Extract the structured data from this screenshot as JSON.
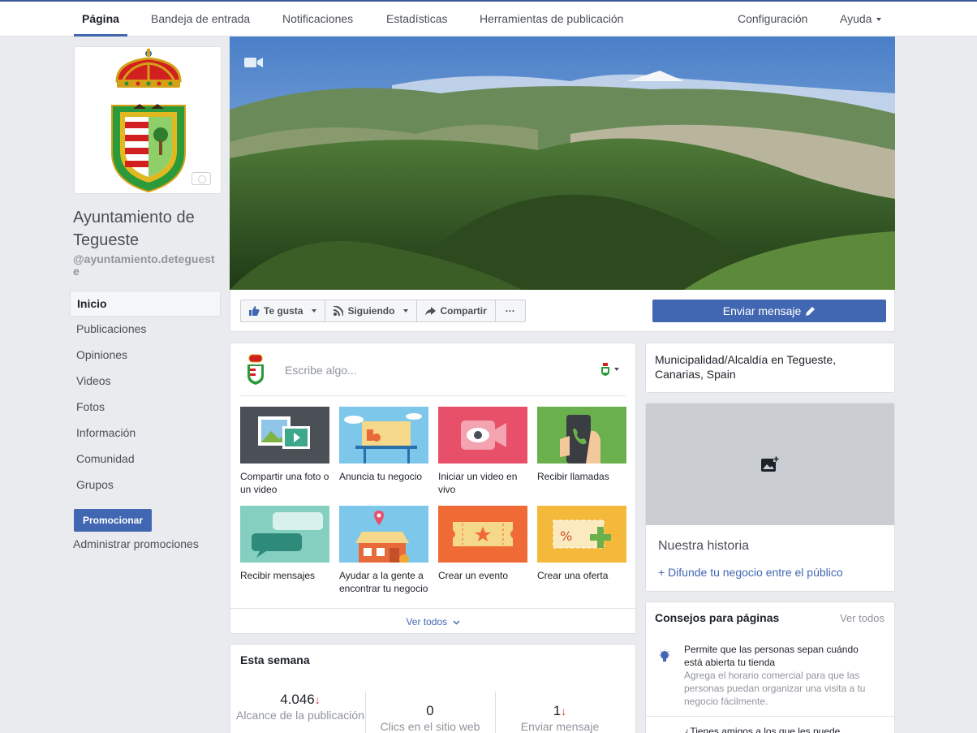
{
  "topnav": {
    "tabs": [
      "Página",
      "Bandeja de entrada",
      "Notificaciones",
      "Estadísticas",
      "Herramientas de publicación"
    ],
    "settings": "Configuración",
    "help": "Ayuda"
  },
  "page": {
    "name": "Ayuntamiento de Tegueste",
    "handle": "@ayuntamiento.detegueste"
  },
  "leftnav": {
    "items": [
      "Inicio",
      "Publicaciones",
      "Opiniones",
      "Videos",
      "Fotos",
      "Información",
      "Comunidad",
      "Grupos"
    ],
    "promote": "Promocionar",
    "manage": "Administrar promociones"
  },
  "actions": {
    "like": "Te gusta",
    "following": "Siguiendo",
    "share": "Compartir",
    "more": "···",
    "send": "Enviar mensaje"
  },
  "composer": {
    "placeholder": "Escribe algo...",
    "tiles": [
      "Compartir una foto o un video",
      "Anuncia tu negocio",
      "Iniciar un video en vivo",
      "Recibir llamadas",
      "Recibir mensajes",
      "Ayudar a la gente a encontrar tu negocio",
      "Crear un evento",
      "Crear una oferta"
    ],
    "see_all": "Ver todos"
  },
  "week": {
    "title": "Esta semana",
    "stats": [
      {
        "value": "4.046",
        "label": "Alcance de la publicación",
        "down": true
      },
      {
        "value": "0",
        "label": "Clics en el sitio web",
        "down": false
      },
      {
        "value": "1",
        "label": "Enviar mensaje",
        "down": true
      }
    ]
  },
  "about": {
    "category": "Municipalidad/Alcaldía en Tegueste, Canarias, Spain"
  },
  "story": {
    "title": "Nuestra historia",
    "action": "+ Difunde tu negocio entre el público"
  },
  "tips": {
    "title": "Consejos para páginas",
    "see_all": "Ver todos",
    "tip1_title": "Permite que las personas sepan cuándo está abierta tu tienda",
    "tip1_desc": "Agrega el horario comercial para que las personas puedan organizar una visita a tu negocio fácilmente.",
    "tip2_title": "¿Tienes amigos a los que les puede"
  },
  "colors": {
    "brand": "#4267b2",
    "background": "#e9ebee",
    "alert": "#e9302d"
  }
}
